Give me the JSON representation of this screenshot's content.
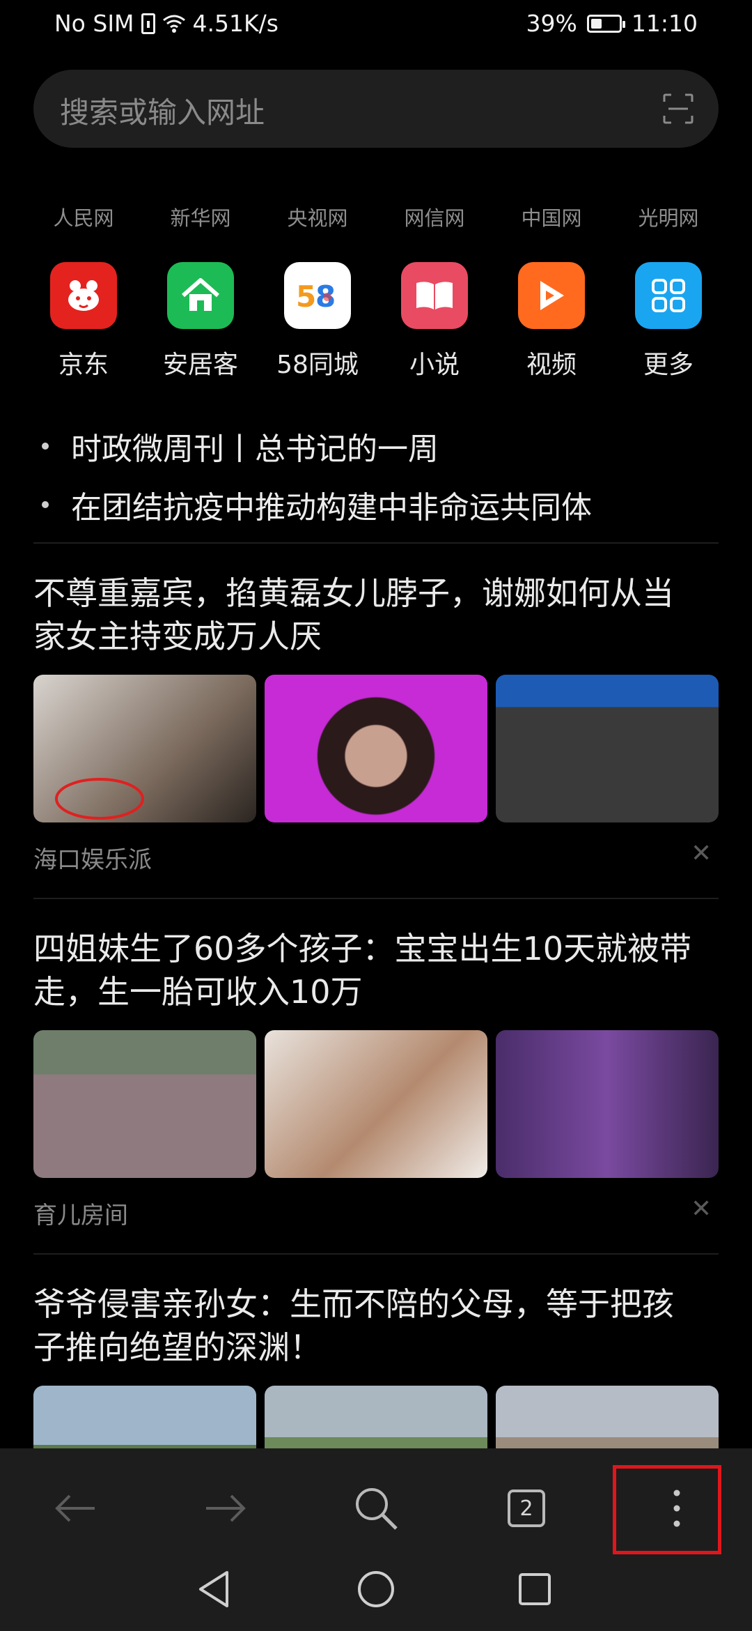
{
  "status_bar": {
    "carrier": "No SIM",
    "speed": "4.51K/s",
    "battery_percent": "39%",
    "battery_level": 0.39,
    "time": "11:10"
  },
  "search": {
    "placeholder": "搜索或输入网址",
    "scan_icon": "scan-icon"
  },
  "sites": [
    "人民网",
    "新华网",
    "央视网",
    "网信网",
    "中国网",
    "光明网"
  ],
  "apps": [
    {
      "label": "京东",
      "icon": "jd-icon",
      "color": "#e4231f"
    },
    {
      "label": "安居客",
      "icon": "house-icon",
      "color": "#1dbb55"
    },
    {
      "label": "58同城",
      "icon": "58-icon",
      "color": "#ffffff"
    },
    {
      "label": "小说",
      "icon": "book-icon",
      "color": "#e94b63"
    },
    {
      "label": "视频",
      "icon": "play-icon",
      "color": "#ff6a1f"
    },
    {
      "label": "更多",
      "icon": "grid-icon",
      "color": "#1aa5f0"
    }
  ],
  "hot_topics": [
    "时政微周刊丨总书记的一周",
    "在团结抗疫中推动构建中非命运共同体"
  ],
  "news": [
    {
      "title_line1": "不尊重嘉宾，掐黄磊女儿脖子，谢娜如何从当",
      "title_line2": "家女主持变成万人厌",
      "source": "海口娱乐派",
      "close": "✕"
    },
    {
      "title_line1": "四姐妹生了60多个孩子：宝宝出生10天就被带",
      "title_line2": "走，生一胎可收入10万",
      "source": "育儿房间",
      "close": "✕"
    },
    {
      "title_line1": "爷爷侵害亲孙女：生而不陪的父母，等于把孩",
      "title_line2": "子推向绝望的深渊！"
    }
  ],
  "toolbar": {
    "tab_count": "2",
    "back_icon": "back-arrow-icon",
    "forward_icon": "forward-arrow-icon",
    "search_icon": "search-icon",
    "menu_icon": "more-vertical-icon"
  },
  "highlight_color": "#e0161c"
}
